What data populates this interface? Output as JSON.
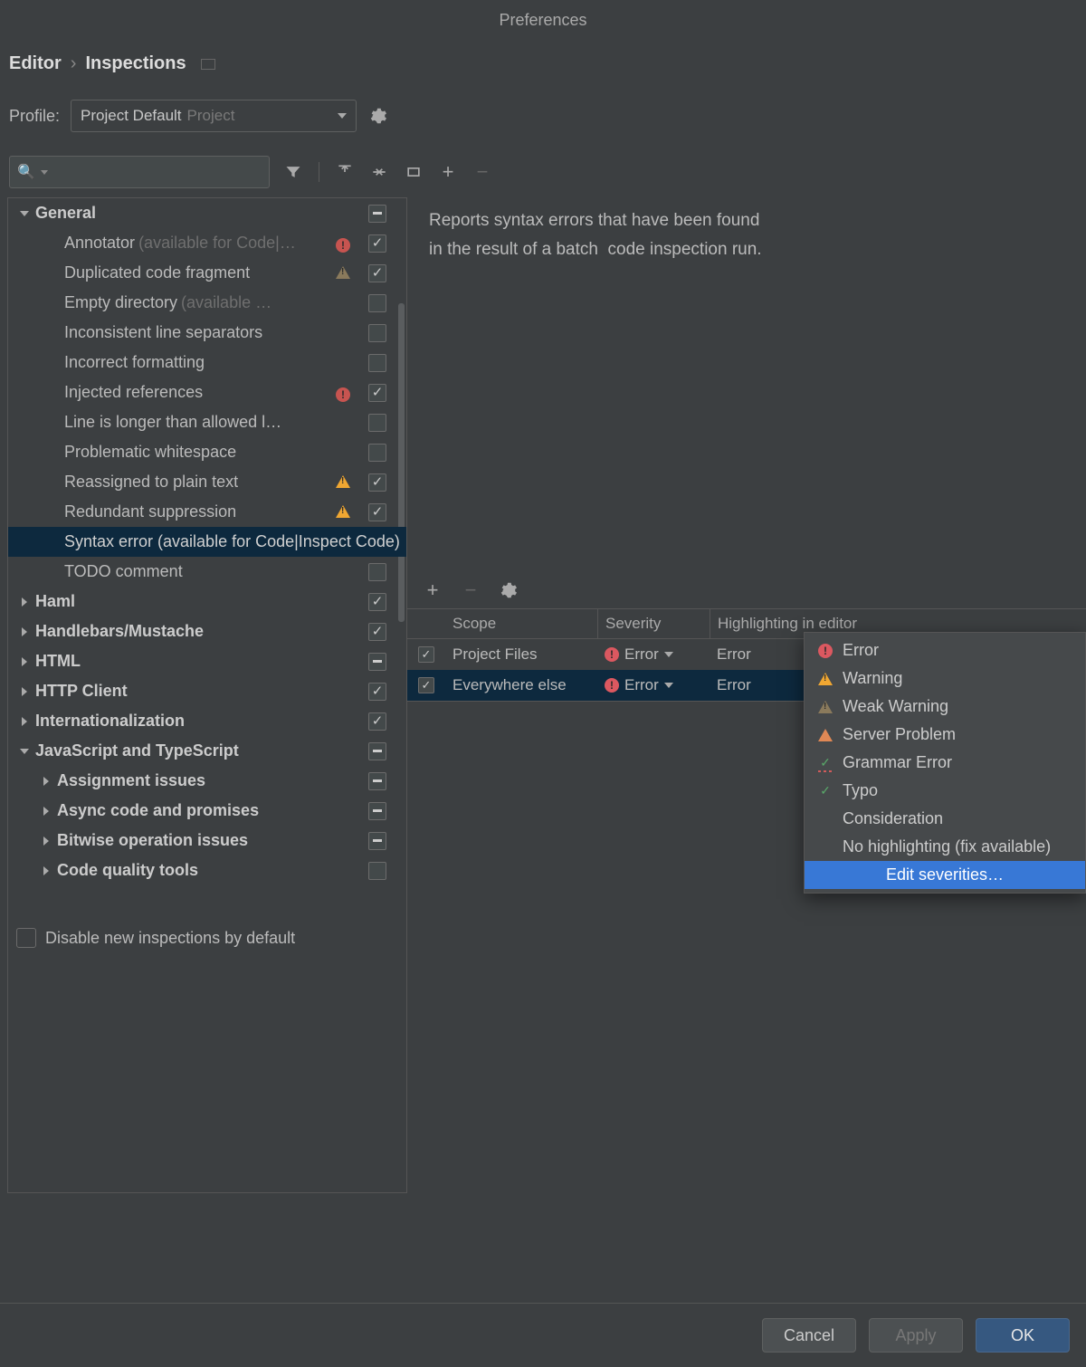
{
  "title": "Preferences",
  "breadcrumb": {
    "editor": "Editor",
    "inspections": "Inspections"
  },
  "profile": {
    "label": "Profile:",
    "value": "Project Default",
    "suffix": "Project"
  },
  "description": {
    "line1": "Reports syntax errors that have been found",
    "line2": "in the result of a batch",
    "line3": "code inspection run."
  },
  "tree": {
    "general": {
      "label": "General",
      "items": [
        {
          "label": "Annotator",
          "suffix": "(available for Code|…",
          "severity": "error",
          "checked": true
        },
        {
          "label": "Duplicated code fragment",
          "suffix": "",
          "severity": "weak",
          "checked": true
        },
        {
          "label": "Empty directory",
          "suffix": "(available …",
          "severity": "",
          "checked": false
        },
        {
          "label": "Inconsistent line separators",
          "suffix": "",
          "severity": "",
          "checked": false
        },
        {
          "label": "Incorrect formatting",
          "suffix": "",
          "severity": "",
          "checked": false
        },
        {
          "label": "Injected references",
          "suffix": "",
          "severity": "error",
          "checked": true
        },
        {
          "label": "Line is longer than allowed l…",
          "suffix": "",
          "severity": "",
          "checked": false
        },
        {
          "label": "Problematic whitespace",
          "suffix": "",
          "severity": "",
          "checked": false
        },
        {
          "label": "Reassigned to plain text",
          "suffix": "",
          "severity": "warn",
          "checked": true
        },
        {
          "label": "Redundant suppression",
          "suffix": "",
          "severity": "warn",
          "checked": true
        },
        {
          "label_full": "Syntax error (available for Code|Inspect Code)"
        },
        {
          "label": "TODO comment",
          "suffix": "",
          "severity": "",
          "checked": false
        }
      ]
    },
    "categories": [
      {
        "label": "Haml",
        "state": "on"
      },
      {
        "label": "Handlebars/Mustache",
        "state": "on"
      },
      {
        "label": "HTML",
        "state": "mixed"
      },
      {
        "label": "HTTP Client",
        "state": "on"
      },
      {
        "label": "Internationalization",
        "state": "on"
      }
    ],
    "js": {
      "label": "JavaScript and TypeScript",
      "state": "mixed",
      "subs": [
        {
          "label": "Assignment issues",
          "state": "mixed"
        },
        {
          "label": "Async code and promises",
          "state": "mixed"
        },
        {
          "label": "Bitwise operation issues",
          "state": "mixed"
        },
        {
          "label": "Code quality tools",
          "state": "off"
        }
      ]
    }
  },
  "disable_label": "Disable new inspections by default",
  "scope": {
    "headers": {
      "scope": "Scope",
      "severity": "Severity",
      "highlight": "Highlighting in editor"
    },
    "rows": [
      {
        "scope": "Project Files",
        "severity": "Error",
        "highlight": "Error"
      },
      {
        "scope": "Everywhere else",
        "severity": "Error",
        "highlight": "Error"
      }
    ]
  },
  "severity_menu": {
    "items": [
      {
        "label": "Error",
        "icon": "error"
      },
      {
        "label": "Warning",
        "icon": "warn"
      },
      {
        "label": "Weak Warning",
        "icon": "weak"
      },
      {
        "label": "Server Problem",
        "icon": "server"
      },
      {
        "label": "Grammar Error",
        "icon": "grammar"
      },
      {
        "label": "Typo",
        "icon": "typo"
      },
      {
        "label": "Consideration",
        "icon": ""
      },
      {
        "label": "No highlighting (fix available)",
        "icon": ""
      }
    ],
    "edit": "Edit severities…"
  },
  "buttons": {
    "cancel": "Cancel",
    "apply": "Apply",
    "ok": "OK"
  }
}
